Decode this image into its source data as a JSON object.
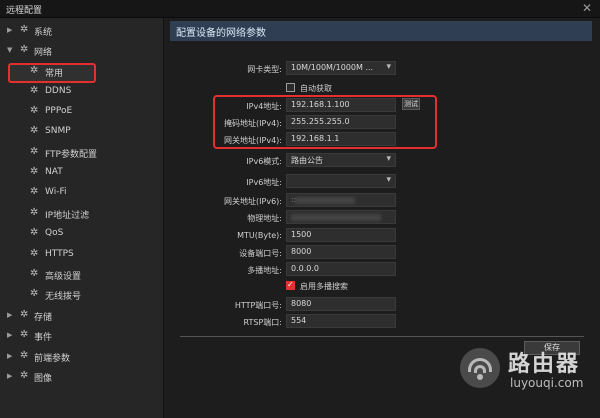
{
  "window": {
    "title": "远程配置",
    "close_glyph": "✕"
  },
  "sidebar": {
    "items": [
      {
        "label": "系统",
        "level": 0,
        "expanded": false
      },
      {
        "label": "网络",
        "level": 0,
        "expanded": true
      },
      {
        "label": "常用",
        "level": 1,
        "selected": true
      },
      {
        "label": "DDNS",
        "level": 1
      },
      {
        "label": "PPPoE",
        "level": 1
      },
      {
        "label": "SNMP",
        "level": 1
      },
      {
        "label": "FTP参数配置",
        "level": 1
      },
      {
        "label": "NAT",
        "level": 1
      },
      {
        "label": "Wi-Fi",
        "level": 1
      },
      {
        "label": "IP地址过滤",
        "level": 1
      },
      {
        "label": "QoS",
        "level": 1
      },
      {
        "label": "HTTPS",
        "level": 1
      },
      {
        "label": "高级设置",
        "level": 1
      },
      {
        "label": "无线拨号",
        "level": 1
      },
      {
        "label": "存储",
        "level": 0,
        "expanded": false
      },
      {
        "label": "事件",
        "level": 0,
        "expanded": false
      },
      {
        "label": "前端参数",
        "level": 0,
        "expanded": false
      },
      {
        "label": "图像",
        "level": 0,
        "expanded": false
      }
    ]
  },
  "main": {
    "section_title": "配置设备的网络参数",
    "nic_type": {
      "label": "网卡类型:",
      "value": "10M/100M/1000M ..."
    },
    "auto_obtain": {
      "label": "自动获取",
      "checked": false
    },
    "ipv4_address": {
      "label": "IPv4地址:",
      "value": "192.168.1.100"
    },
    "test_button": "测试",
    "ipv4_mask": {
      "label": "掩码地址(IPv4):",
      "value": "255.255.255.0"
    },
    "ipv4_gateway": {
      "label": "网关地址(IPv4):",
      "value": "192.168.1.1"
    },
    "ipv6_mode": {
      "label": "IPv6模式:",
      "value": "路由公告"
    },
    "ipv6_address": {
      "label": "IPv6地址:",
      "value": ""
    },
    "ipv6_gateway": {
      "label": "网关地址(IPv6):",
      "value": "::"
    },
    "mac_address": {
      "label": "物理地址:",
      "value": ""
    },
    "mtu": {
      "label": "MTU(Byte):",
      "value": "1500"
    },
    "device_port": {
      "label": "设备端口号:",
      "value": "8000"
    },
    "multicast": {
      "label": "多播地址:",
      "value": "0.0.0.0"
    },
    "multicast_search": {
      "label": "启用多播搜索",
      "checked": true
    },
    "http_port": {
      "label": "HTTP端口号:",
      "value": "8080"
    },
    "rtsp_port": {
      "label": "RTSP端口:",
      "value": "554"
    },
    "save_button": "保存"
  },
  "watermark": {
    "cn": "路由器",
    "en": "luyouqi.com"
  },
  "colors": {
    "accent_red": "#e3302f",
    "header_blue": "#2f3e52",
    "background": "#1e1e1e"
  }
}
